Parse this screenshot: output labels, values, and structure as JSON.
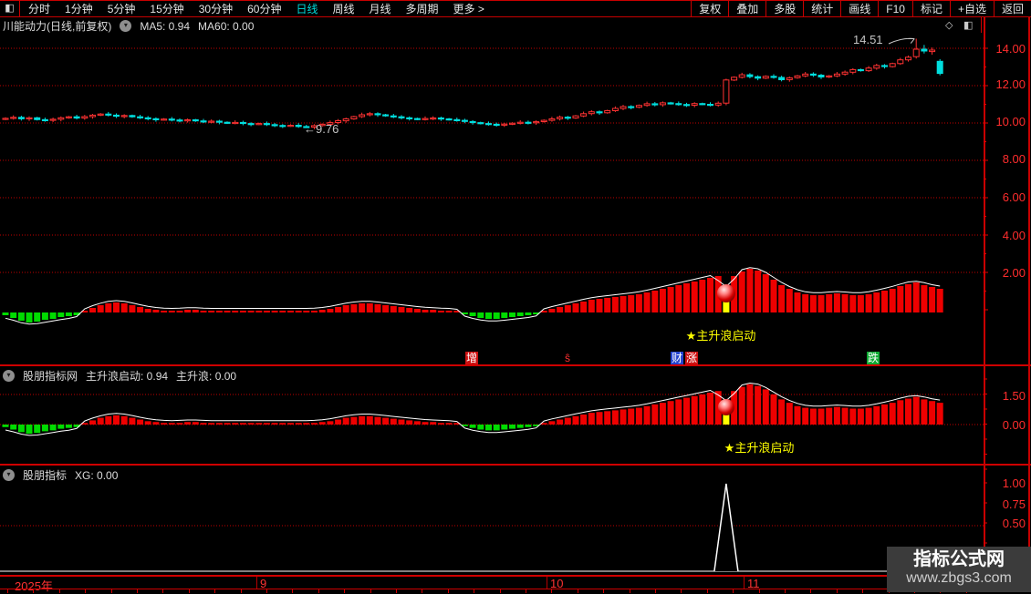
{
  "toolbar": {
    "window_icon": "◧",
    "periods": [
      {
        "label": "分时",
        "active": false
      },
      {
        "label": "1分钟",
        "active": false
      },
      {
        "label": "5分钟",
        "active": false
      },
      {
        "label": "15分钟",
        "active": false
      },
      {
        "label": "30分钟",
        "active": false
      },
      {
        "label": "60分钟",
        "active": false
      },
      {
        "label": "日线",
        "active": true
      },
      {
        "label": "周线",
        "active": false
      },
      {
        "label": "月线",
        "active": false
      },
      {
        "label": "多周期",
        "active": false
      },
      {
        "label": "更多 >",
        "active": false
      }
    ],
    "buttons": [
      "复权",
      "叠加",
      "多股",
      "统计",
      "画线",
      "F10",
      "标记",
      "+自选",
      "返回"
    ]
  },
  "main_panel": {
    "chevron_icon": "▾",
    "diamond_icon": "◇",
    "window_icon": "◧",
    "markers": [
      {
        "text": "增",
        "bg": "#cc1111",
        "fg": "#ffffff"
      },
      {
        "text": "ŝ",
        "bg": "transparent",
        "fg": "#ff3030"
      },
      {
        "text": "财",
        "bg": "#2343cf",
        "fg": "#ffffff"
      },
      {
        "text": "涨",
        "bg": "#cc1111",
        "fg": "#ffffff"
      },
      {
        "text": "跌",
        "bg": "#0faa33",
        "fg": "#ffffff"
      }
    ]
  },
  "timeline": {
    "labels": [
      "2025年",
      "9",
      "10",
      "11"
    ]
  },
  "watermark": {
    "line1": "指标公式网",
    "line2": "www.zbgs3.com"
  },
  "colors": {
    "accent_red": "#cf0000",
    "axis_text": "#ff2d2d",
    "active_tab": "#00dcdc",
    "signal_yellow": "#ffff00"
  },
  "chart_data": [
    {
      "type": "candlestick",
      "title": "川能动力(日线,前复权)",
      "indicators": [
        "MA5: 0.94",
        "MA60: 0.00"
      ],
      "y_ticks": [
        14,
        12,
        10,
        8,
        6,
        4,
        2
      ],
      "y_tick_labels": [
        "14.00",
        "12.00",
        "10.00",
        "8.00",
        "6.00",
        "4.00",
        "2.00"
      ],
      "ylim": [
        1.2,
        14.9
      ],
      "x_months": [
        "2025年",
        "9",
        "10",
        "11"
      ],
      "annotations": {
        "high": {
          "value": 14.51,
          "display": "14.51",
          "index": 115
        },
        "low": {
          "value": 9.76,
          "display": "←9.76",
          "index": 38
        }
      },
      "first_open": 10.2,
      "closes": [
        10.25,
        10.3,
        10.22,
        10.28,
        10.18,
        10.14,
        10.2,
        10.28,
        10.33,
        10.26,
        10.34,
        10.42,
        10.48,
        10.42,
        10.36,
        10.4,
        10.33,
        10.28,
        10.23,
        10.18,
        10.21,
        10.16,
        10.13,
        10.17,
        10.11,
        10.07,
        10.1,
        10.04,
        10.0,
        10.03,
        9.97,
        9.94,
        9.97,
        9.91,
        9.87,
        9.84,
        9.88,
        9.81,
        9.78,
        9.86,
        9.93,
        10.02,
        10.12,
        10.22,
        10.34,
        10.44,
        10.5,
        10.44,
        10.38,
        10.33,
        10.28,
        10.24,
        10.2,
        10.24,
        10.27,
        10.22,
        10.18,
        10.14,
        10.08,
        10.02,
        9.97,
        9.93,
        9.9,
        9.94,
        9.99,
        10.04,
        10.01,
        10.07,
        10.14,
        10.22,
        10.31,
        10.27,
        10.38,
        10.5,
        10.6,
        10.55,
        10.66,
        10.78,
        10.88,
        10.84,
        10.94,
        11.03,
        10.98,
        11.08,
        11.04,
        10.99,
        10.95,
        11.04,
        11.0,
        10.96,
        11.06,
        12.3,
        12.45,
        12.58,
        12.48,
        12.4,
        12.5,
        12.44,
        12.32,
        12.42,
        12.52,
        12.62,
        12.56,
        12.46,
        12.52,
        12.62,
        12.72,
        12.86,
        12.8,
        12.94,
        13.08,
        13.02,
        13.18,
        13.38,
        13.52,
        13.95,
        13.85,
        13.9,
        12.65
      ],
      "specials": {
        "38": {
          "l": 9.76
        },
        "91": {
          "o": 11.06
        },
        "115": {
          "o": 13.55,
          "h": 14.51,
          "l": 13.45
        },
        "116": {
          "o": 13.95,
          "h": 14.18,
          "l": 13.72
        },
        "117": {
          "o": 13.82,
          "h": 14.04,
          "l": 13.66
        },
        "118": {
          "o": 13.3,
          "h": 13.42,
          "l": 12.55
        }
      },
      "up_color": "#ff3232",
      "down_color": "#00dede"
    },
    {
      "type": "bar",
      "name": "股朋指标网",
      "readouts": [
        "主升浪启动: 0.94",
        "主升浪: 0.00"
      ],
      "signal_text": "★主升浪启动",
      "signal_index": 91,
      "axis_labels": [
        "1.50",
        "0.00"
      ],
      "values": [
        -3,
        -6,
        -9,
        -11,
        -10,
        -8,
        -7,
        -5,
        -4,
        -3,
        2,
        5,
        8,
        10,
        11,
        10,
        8,
        6,
        4,
        3,
        2,
        2,
        2,
        3,
        3,
        2,
        2,
        2,
        2,
        2,
        2,
        2,
        2,
        2,
        2,
        2,
        2,
        2,
        2,
        2,
        3,
        4,
        6,
        8,
        9,
        10,
        10,
        9,
        8,
        7,
        6,
        5,
        4,
        3,
        3,
        2,
        2,
        2,
        -2,
        -4,
        -6,
        -7,
        -7,
        -6,
        -5,
        -4,
        -3,
        -2,
        2,
        4,
        6,
        8,
        10,
        12,
        14,
        15,
        16,
        17,
        18,
        19,
        20,
        22,
        24,
        26,
        28,
        30,
        32,
        34,
        36,
        38,
        40,
        12,
        40,
        45,
        48,
        46,
        42,
        36,
        30,
        26,
        22,
        20,
        19,
        19,
        20,
        21,
        20,
        19,
        19,
        20,
        22,
        24,
        26,
        29,
        31,
        33,
        30,
        28,
        26
      ],
      "bar_up_color": "#ee0000",
      "bar_down_color": "#00dc00",
      "signal_bar_color": "#ffff00",
      "envelope_color": "#ffffff"
    },
    {
      "type": "line",
      "name": "股朋指标",
      "readouts": [
        "XG: 0.00"
      ],
      "axis_labels": [
        "1.00",
        "0.75",
        "0.50"
      ],
      "spike": {
        "index": 91,
        "value": 1.0
      },
      "line_color": "#ffffff"
    }
  ]
}
